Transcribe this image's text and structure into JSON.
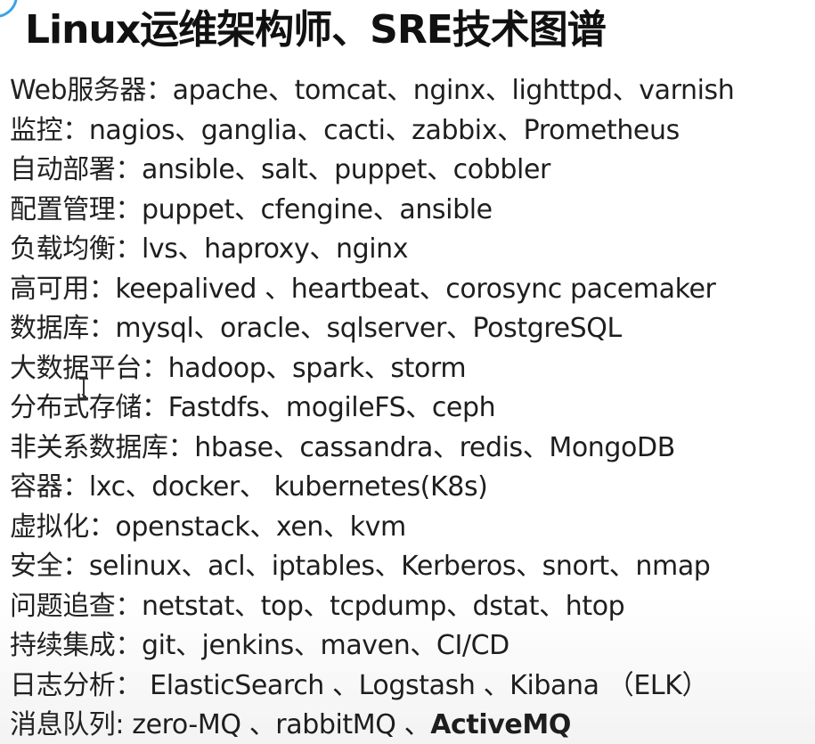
{
  "title": "Linux运维架构师、SRE技术图谱",
  "rows": [
    {
      "label": "Web服务器：",
      "items": "apache、tomcat、nginx、lighttpd、varnish"
    },
    {
      "label": "监控：",
      "items": "nagios、ganglia、cacti、zabbix、Prometheus"
    },
    {
      "label": "自动部署：",
      "items": "ansible、salt、puppet、cobbler"
    },
    {
      "label": "配置管理：",
      "items": "puppet、cfengine、ansible"
    },
    {
      "label": "负载均衡：",
      "items": "lvs、haproxy、nginx"
    },
    {
      "label": "高可用：",
      "items": "keepalived 、heartbeat、corosync pacemaker"
    },
    {
      "label": "数据库：",
      "items": "mysql、oracle、sqlserver、PostgreSQL"
    },
    {
      "label": "大数据平台：",
      "items": "hadoop、spark、storm"
    },
    {
      "label": "分布式存储：",
      "items": "Fastdfs、mogileFS、ceph"
    },
    {
      "label": "非关系数据库：",
      "items": "hbase、cassandra、redis、MongoDB"
    },
    {
      "label": "容器：",
      "items": "lxc、docker、 kubernetes(K8s)"
    },
    {
      "label": "虚拟化：",
      "items": "openstack、xen、kvm"
    },
    {
      "label": "安全：",
      "items": "selinux、acl、iptables、Kerberos、snort、nmap"
    },
    {
      "label": "问题追查：",
      "items": "netstat、top、tcpdump、dstat、htop"
    },
    {
      "label": "持续集成：",
      "items": "git、jenkins、maven、CI/CD"
    },
    {
      "label": "日志分析：",
      "items": " ElasticSearch 、Logstash 、Kibana （ELK）"
    },
    {
      "label": "消息队列:",
      "items": " zero-MQ 、rabbitMQ 、",
      "items_bold": "ActiveMQ"
    }
  ]
}
